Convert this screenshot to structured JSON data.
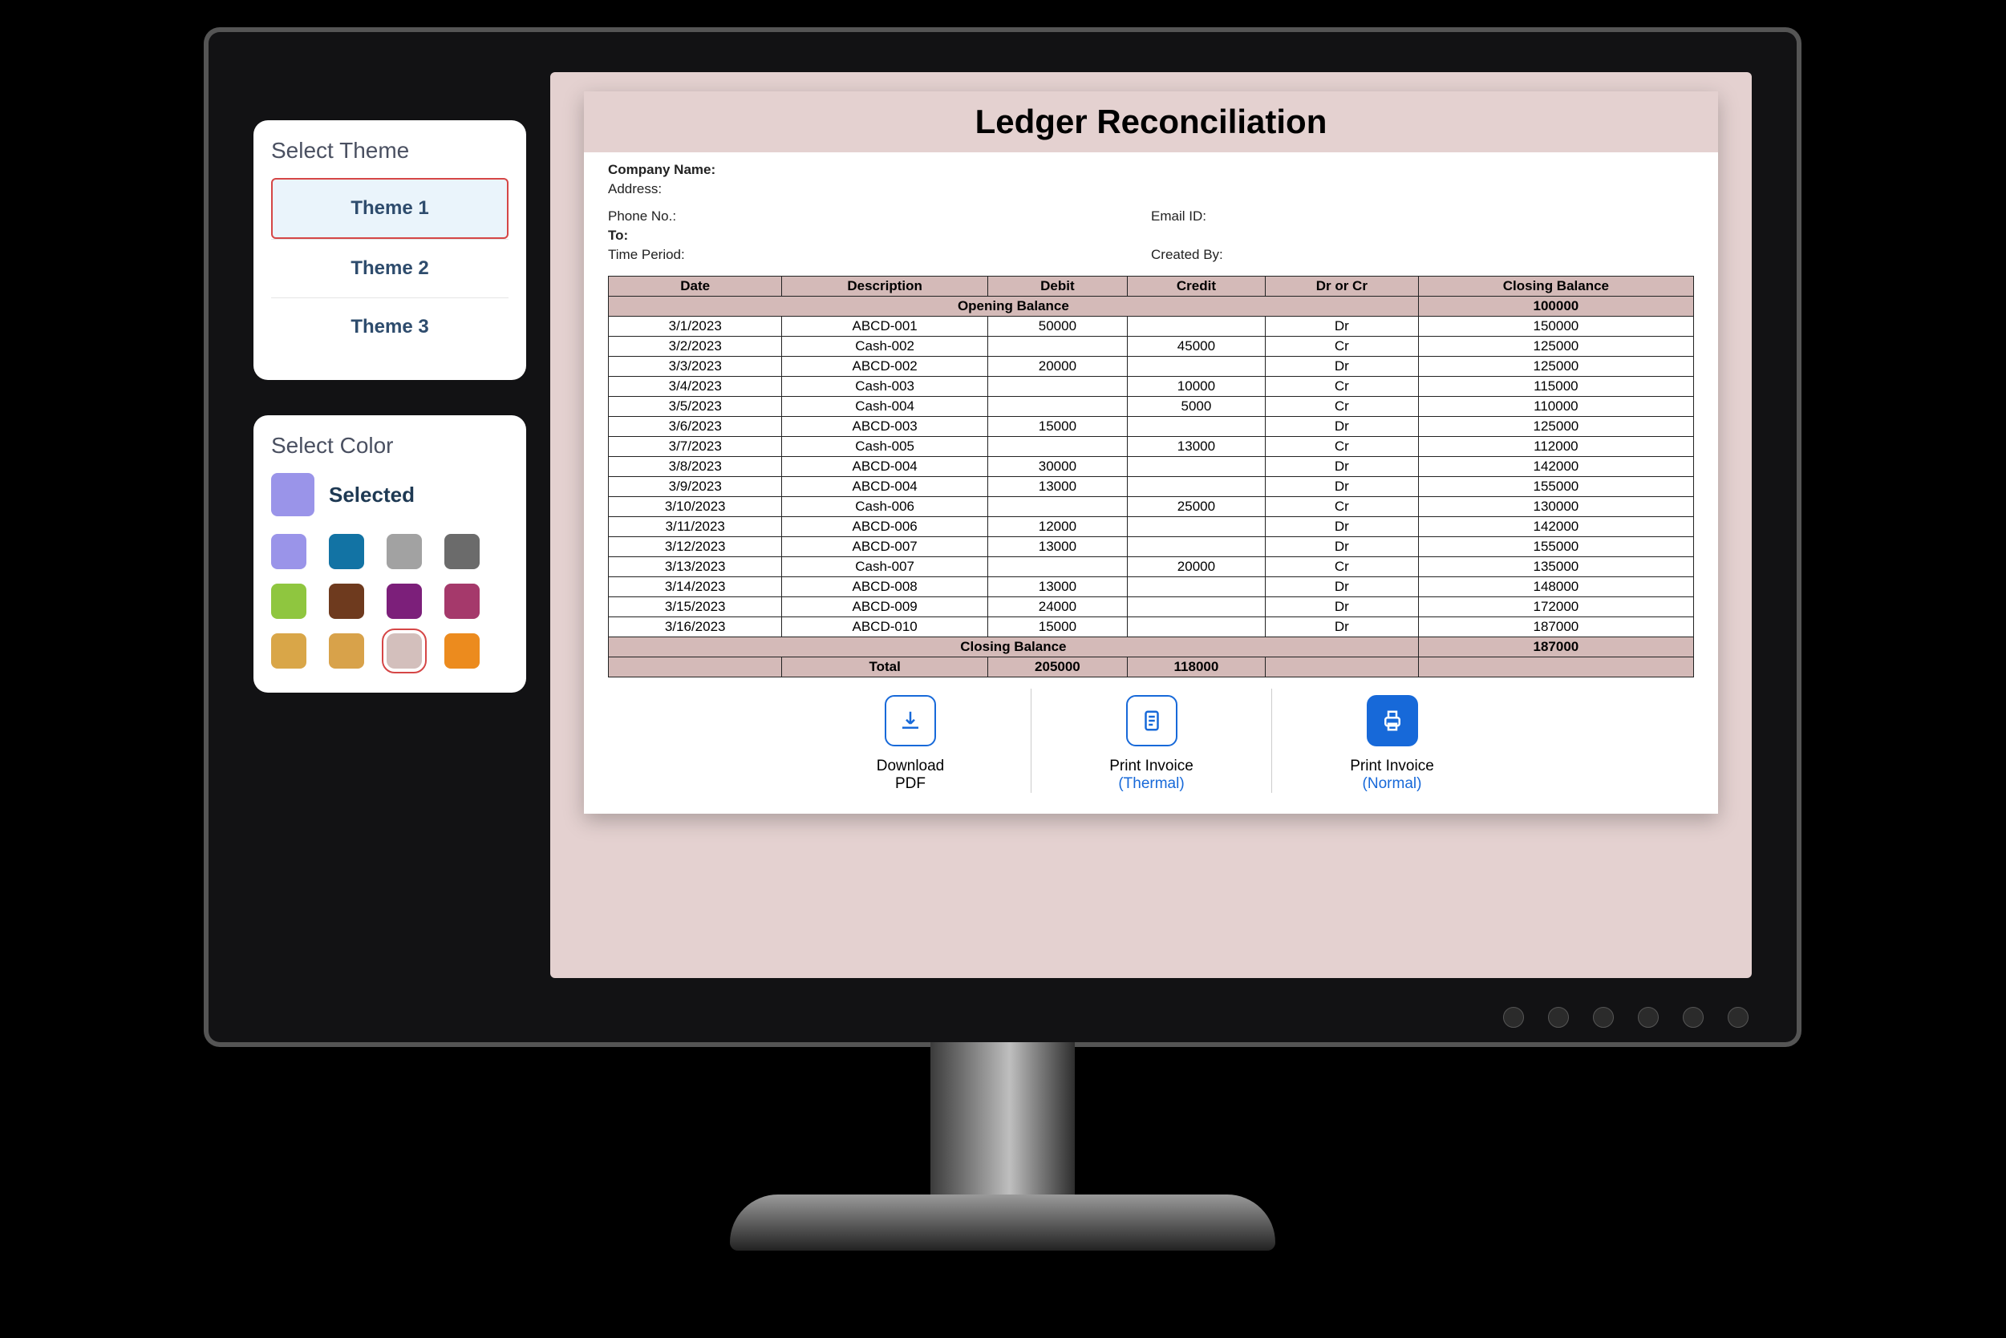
{
  "sidebar": {
    "theme_heading": "Select Theme",
    "themes": [
      "Theme 1",
      "Theme 2",
      "Theme 3"
    ],
    "color_heading": "Select Color",
    "selected_label": "Selected",
    "selected_color": "#9a94e9",
    "palette": [
      "#9a94e9",
      "#1273a4",
      "#a2a2a2",
      "#6b6b6b",
      "#8fc63f",
      "#6e3a1e",
      "#7c1f7a",
      "#a5396b",
      "#d9a648",
      "#d8a24a",
      "#d3bfbc",
      "#ec8b1e"
    ],
    "palette_selected_index": 10
  },
  "document": {
    "title": "Ledger Reconciliation",
    "labels": {
      "company": "Company Name:",
      "address": "Address:",
      "phone": "Phone No.:",
      "email": "Email ID:",
      "to": "To:",
      "period": "Time Period:",
      "created_by": "Created By:"
    },
    "columns": [
      "Date",
      "Description",
      "Debit",
      "Credit",
      "Dr or Cr",
      "Closing Balance"
    ],
    "opening_balance_label": "Opening Balance",
    "opening_balance_value": "100000",
    "closing_balance_label": "Closing Balance",
    "closing_balance_value": "187000",
    "total_label": "Total",
    "total_debit": "205000",
    "total_credit": "118000",
    "rows": [
      {
        "date": "3/1/2023",
        "desc": "ABCD-001",
        "debit": "50000",
        "credit": "",
        "drcr": "Dr",
        "close": "150000"
      },
      {
        "date": "3/2/2023",
        "desc": "Cash-002",
        "debit": "",
        "credit": "45000",
        "drcr": "Cr",
        "close": "125000"
      },
      {
        "date": "3/3/2023",
        "desc": "ABCD-002",
        "debit": "20000",
        "credit": "",
        "drcr": "Dr",
        "close": "125000"
      },
      {
        "date": "3/4/2023",
        "desc": "Cash-003",
        "debit": "",
        "credit": "10000",
        "drcr": "Cr",
        "close": "115000"
      },
      {
        "date": "3/5/2023",
        "desc": "Cash-004",
        "debit": "",
        "credit": "5000",
        "drcr": "Cr",
        "close": "110000"
      },
      {
        "date": "3/6/2023",
        "desc": "ABCD-003",
        "debit": "15000",
        "credit": "",
        "drcr": "Dr",
        "close": "125000"
      },
      {
        "date": "3/7/2023",
        "desc": "Cash-005",
        "debit": "",
        "credit": "13000",
        "drcr": "Cr",
        "close": "112000"
      },
      {
        "date": "3/8/2023",
        "desc": "ABCD-004",
        "debit": "30000",
        "credit": "",
        "drcr": "Dr",
        "close": "142000"
      },
      {
        "date": "3/9/2023",
        "desc": "ABCD-004",
        "debit": "13000",
        "credit": "",
        "drcr": "Dr",
        "close": "155000"
      },
      {
        "date": "3/10/2023",
        "desc": "Cash-006",
        "debit": "",
        "credit": "25000",
        "drcr": "Cr",
        "close": "130000"
      },
      {
        "date": "3/11/2023",
        "desc": "ABCD-006",
        "debit": "12000",
        "credit": "",
        "drcr": "Dr",
        "close": "142000"
      },
      {
        "date": "3/12/2023",
        "desc": "ABCD-007",
        "debit": "13000",
        "credit": "",
        "drcr": "Dr",
        "close": "155000"
      },
      {
        "date": "3/13/2023",
        "desc": "Cash-007",
        "debit": "",
        "credit": "20000",
        "drcr": "Cr",
        "close": "135000"
      },
      {
        "date": "3/14/2023",
        "desc": "ABCD-008",
        "debit": "13000",
        "credit": "",
        "drcr": "Dr",
        "close": "148000"
      },
      {
        "date": "3/15/2023",
        "desc": "ABCD-009",
        "debit": "24000",
        "credit": "",
        "drcr": "Dr",
        "close": "172000"
      },
      {
        "date": "3/16/2023",
        "desc": "ABCD-010",
        "debit": "15000",
        "credit": "",
        "drcr": "Dr",
        "close": "187000"
      }
    ],
    "actions": {
      "download_l1": "Download",
      "download_l2": "PDF",
      "thermal_l1": "Print Invoice",
      "thermal_l2": "(Thermal)",
      "normal_l1": "Print Invoice",
      "normal_l2": "(Normal)"
    }
  }
}
